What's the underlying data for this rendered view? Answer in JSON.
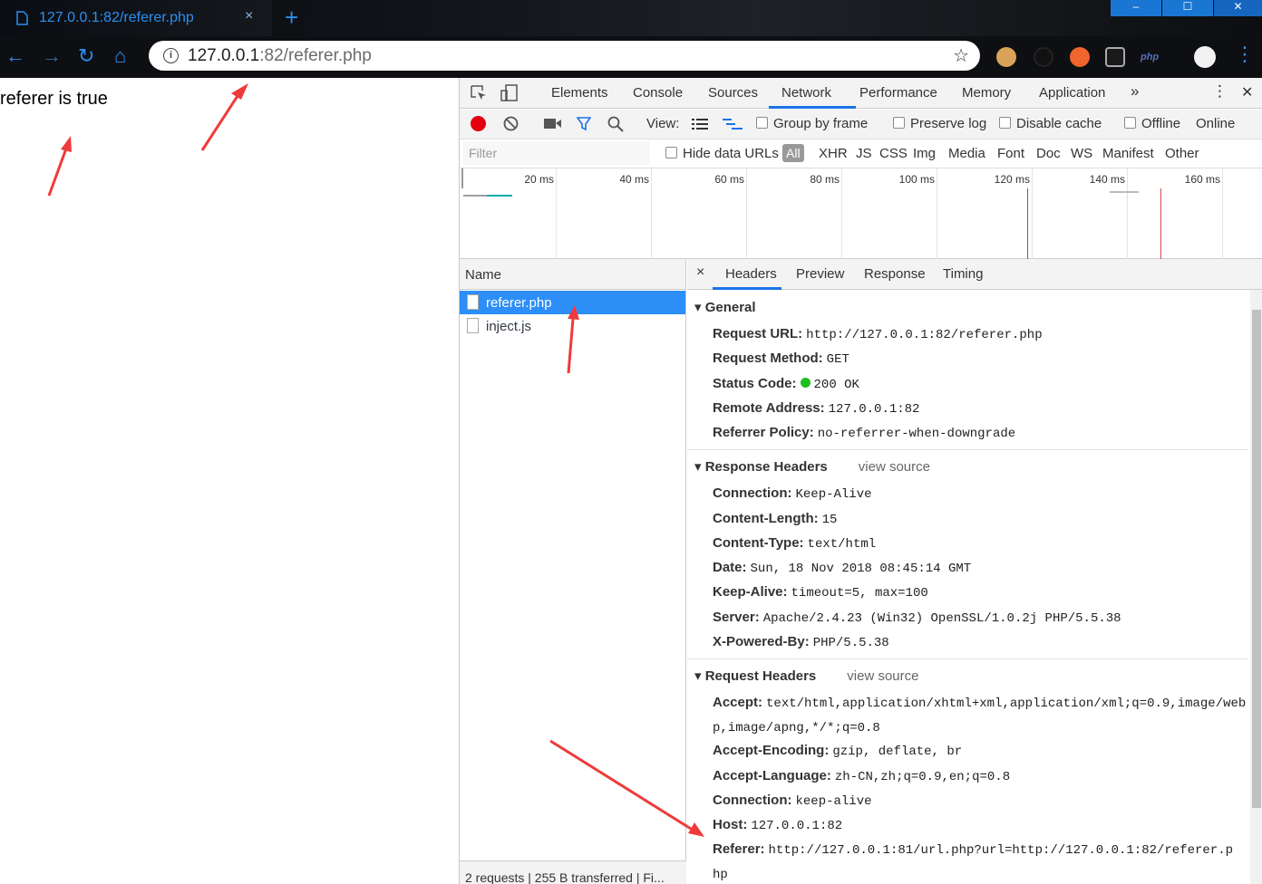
{
  "tab": {
    "title": "127.0.0.1:82/referer.php",
    "close": "×",
    "new_tab": "+"
  },
  "window": {
    "minimize": "–",
    "maximize": "☐",
    "close": "✕"
  },
  "nav": {
    "back": "←",
    "forward": "→",
    "reload": "↻",
    "home": "⌂"
  },
  "omnibox": {
    "host": "127.0.0.1",
    "path": ":82/referer.php",
    "info_icon": "i",
    "star": "☆"
  },
  "extensions": [
    "cookie-icon",
    "circle-icon",
    "lifebuoy-icon",
    "glasses-icon",
    "php-icon",
    "avatar-icon",
    "menu-icon"
  ],
  "ext_php_label": "php",
  "page": {
    "text": "referer is true"
  },
  "devtools": {
    "tabs": [
      "Elements",
      "Console",
      "Sources",
      "Network",
      "Performance",
      "Memory",
      "Application"
    ],
    "active_tab": "Network",
    "more": "»",
    "menu": "⋮",
    "close": "✕",
    "controls": {
      "view_label": "View:",
      "group_by_frame": "Group by frame",
      "preserve_log": "Preserve log",
      "disable_cache": "Disable cache",
      "offline": "Offline",
      "throttle": "Online"
    },
    "filter": {
      "placeholder": "Filter",
      "hide_data_urls": "Hide data URLs",
      "types": [
        "All",
        "XHR",
        "JS",
        "CSS",
        "Img",
        "Media",
        "Font",
        "Doc",
        "WS",
        "Manifest",
        "Other"
      ]
    },
    "timeline_ticks": [
      "20 ms",
      "40 ms",
      "60 ms",
      "80 ms",
      "100 ms",
      "120 ms",
      "140 ms",
      "160 ms"
    ],
    "name_header": "Name",
    "requests": [
      "referer.php",
      "inject.js"
    ],
    "selected_request": "referer.php",
    "status": "2 requests | 255 B transferred | Fi...",
    "detail_tabs": [
      "Headers",
      "Preview",
      "Response",
      "Timing"
    ],
    "detail_close": "×",
    "general": {
      "title": "General",
      "rows": [
        {
          "k": "Request URL:",
          "v": "http://127.0.0.1:82/referer.php"
        },
        {
          "k": "Request Method:",
          "v": "GET"
        },
        {
          "k": "Status Code:",
          "v": "200 OK"
        },
        {
          "k": "Remote Address:",
          "v": "127.0.0.1:82"
        },
        {
          "k": "Referrer Policy:",
          "v": "no-referrer-when-downgrade"
        }
      ]
    },
    "response_headers": {
      "title": "Response Headers",
      "view_source": "view source",
      "rows": [
        {
          "k": "Connection:",
          "v": "Keep-Alive"
        },
        {
          "k": "Content-Length:",
          "v": "15"
        },
        {
          "k": "Content-Type:",
          "v": "text/html"
        },
        {
          "k": "Date:",
          "v": "Sun, 18 Nov 2018 08:45:14 GMT"
        },
        {
          "k": "Keep-Alive:",
          "v": "timeout=5, max=100"
        },
        {
          "k": "Server:",
          "v": "Apache/2.4.23 (Win32) OpenSSL/1.0.2j PHP/5.5.38"
        },
        {
          "k": "X-Powered-By:",
          "v": "PHP/5.5.38"
        }
      ]
    },
    "request_headers": {
      "title": "Request Headers",
      "view_source": "view source",
      "rows": [
        {
          "k": "Accept:",
          "v": "text/html,application/xhtml+xml,application/xml;q=0.9,image/web",
          "v2": "p,image/apng,*/*;q=0.8"
        },
        {
          "k": "Accept-Encoding:",
          "v": "gzip, deflate, br"
        },
        {
          "k": "Accept-Language:",
          "v": "zh-CN,zh;q=0.9,en;q=0.8"
        },
        {
          "k": "Connection:",
          "v": "keep-alive"
        },
        {
          "k": "Host:",
          "v": "127.0.0.1:82"
        },
        {
          "k": "Referer:",
          "v": "http://127.0.0.1:81/url.php?url=http://127.0.0.1:82/referer.p",
          "v2": "hp"
        }
      ]
    }
  },
  "colors": {
    "accent": "#2d8ff0",
    "selected_row": "#2d8ef8",
    "annotation_arrow": "#f03a3a",
    "status_green": "#1dbf1d"
  }
}
